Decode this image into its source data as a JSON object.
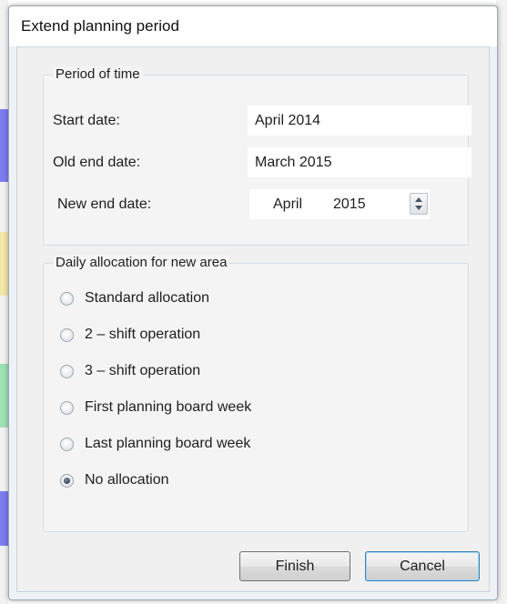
{
  "dialog": {
    "title": "Extend planning period"
  },
  "period": {
    "legend": "Period of time",
    "start_label": "Start date:",
    "start_value": "April 2014",
    "old_end_label": "Old end date:",
    "old_end_value": "March 2015",
    "new_end_label": "New end date:",
    "new_end_month": "April",
    "new_end_year": "2015"
  },
  "allocation": {
    "legend": "Daily allocation for new area",
    "options": [
      {
        "label": "Standard allocation",
        "checked": false
      },
      {
        "label": "2 – shift operation",
        "checked": false
      },
      {
        "label": "3 – shift operation",
        "checked": false
      },
      {
        "label": "First planning board week",
        "checked": false
      },
      {
        "label": "Last planning board week",
        "checked": false
      },
      {
        "label": "No allocation",
        "checked": true
      }
    ]
  },
  "buttons": {
    "finish": "Finish",
    "cancel": "Cancel"
  }
}
